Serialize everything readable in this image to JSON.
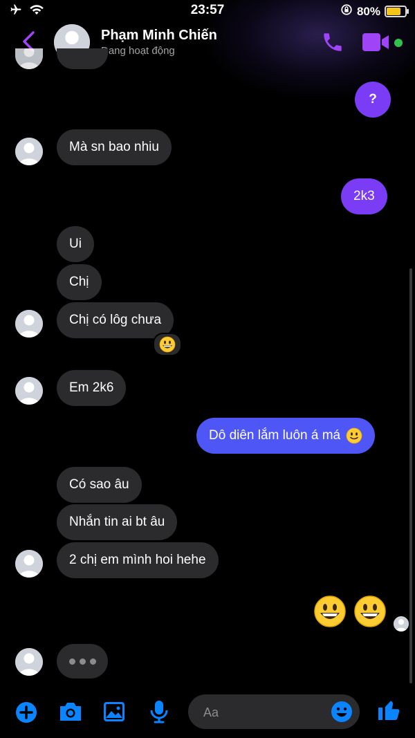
{
  "status_bar": {
    "time": "23:57",
    "battery_percent": "80%",
    "battery_level": 0.8
  },
  "header": {
    "name": "Phạm Minh Chiến",
    "status": "Đang hoạt động"
  },
  "messages": {
    "m1": "?",
    "m2": "Mà sn bao nhiu",
    "m3": "2k3",
    "m4": "Ui",
    "m5": "Chị",
    "m6": "Chị có lôg chưa",
    "m7": "Em 2k6",
    "m8": "Dô diên lắm luôn á má",
    "m9": "Có sao âu",
    "m10": "Nhắn tin ai bt âu",
    "m11": "2 chị em mình hoi hehe"
  },
  "composer": {
    "placeholder": "Aa"
  },
  "colors": {
    "accent": "#7a3cf5",
    "blue_bubble": "#4e57f5",
    "incoming_bubble": "#2b2b2d",
    "online": "#31c24d"
  },
  "icons": [
    "airplane-icon",
    "wifi-icon",
    "lock-rotation-icon",
    "battery-icon",
    "back-icon",
    "phone-icon",
    "video-icon",
    "plus-icon",
    "camera-icon",
    "image-icon",
    "mic-icon",
    "emoji-icon",
    "like-icon"
  ]
}
